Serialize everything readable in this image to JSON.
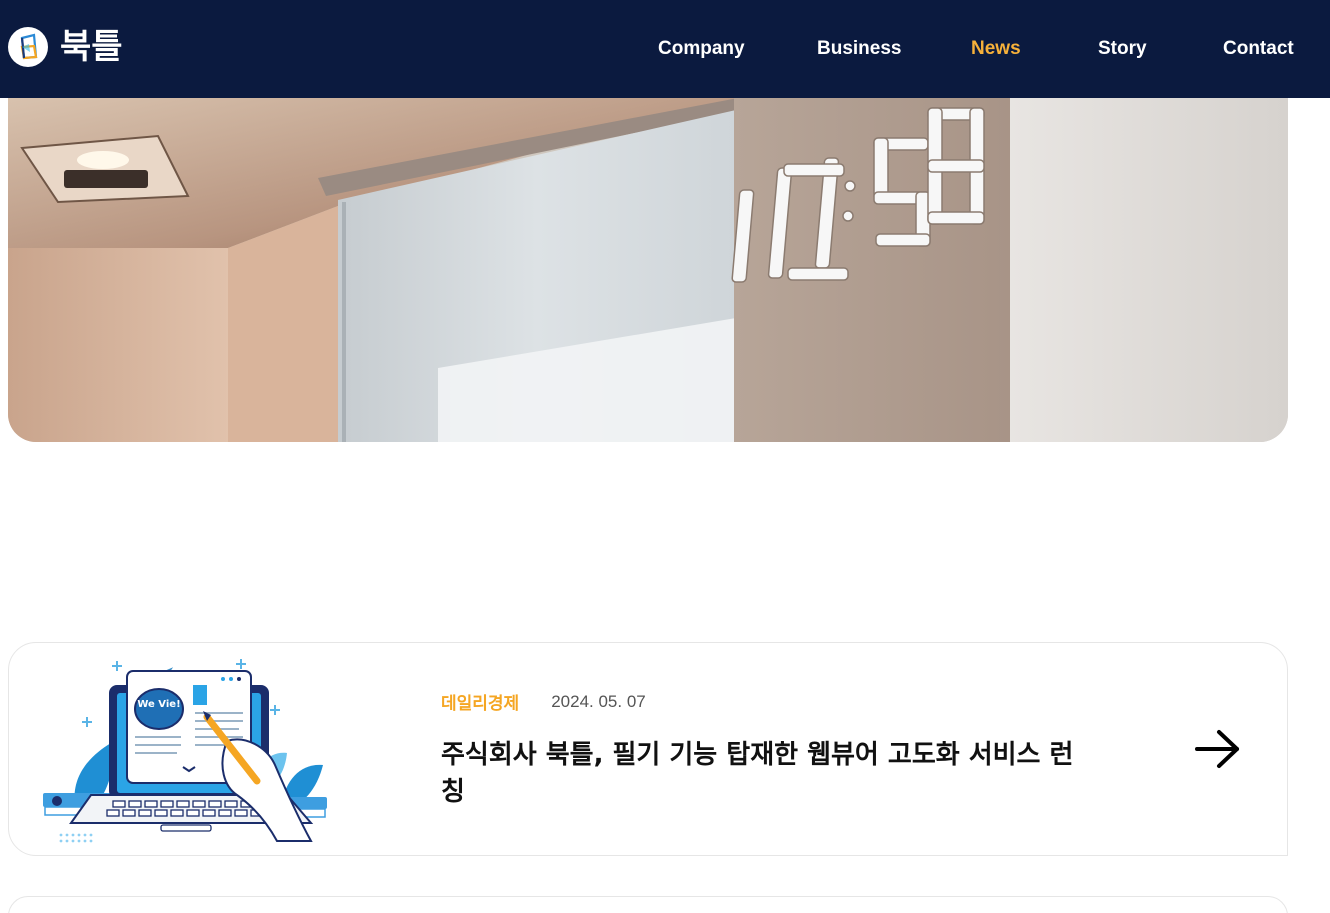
{
  "brand": {
    "name": "북틀"
  },
  "nav": {
    "items": [
      {
        "label": "Company"
      },
      {
        "label": "Business"
      },
      {
        "label": "News",
        "active": true
      },
      {
        "label": "Story"
      },
      {
        "label": "Contact"
      }
    ]
  },
  "hero": {
    "clock_display": "10:58"
  },
  "articles": [
    {
      "source": "데일리경제",
      "date": "2024. 05. 07",
      "title": "주식회사 북틀, 필기 기능 탑재한 웹뷰어 고도화 서비스 런칭",
      "thumbnail_text": "We Vie!"
    }
  ],
  "colors": {
    "header_bg": "#0b1a3f",
    "nav_active": "#f7b13a",
    "source_accent": "#f5a623"
  }
}
